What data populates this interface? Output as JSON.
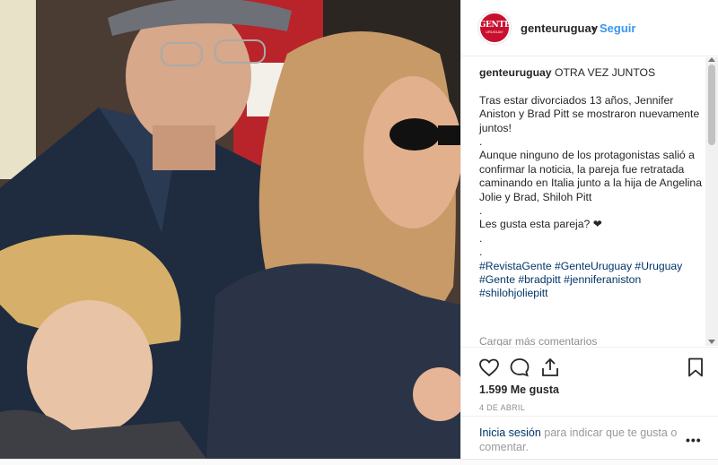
{
  "post": {
    "username": "genteuruguay",
    "dot": "•",
    "follow_label": "Seguir",
    "avatar_logo_main": "GENTE",
    "avatar_logo_sub": "URUGUAY",
    "photo_alt": "Foto del post"
  },
  "caption": {
    "username": "genteuruguay",
    "title": "OTRA VEZ JUNTOS",
    "para1": "Tras estar divorciados 13 años, Jennifer Aniston y Brad Pitt se mostraron nuevamente juntos!",
    "sep1": ".",
    "para2": "Aunque ninguno de los protagonistas salió a confirmar la noticia, la pareja fue retratada caminando en Italia junto a la hija de Angelina Jolie y Brad, Shiloh Pitt",
    "sep2": ".",
    "para3": "Les gusta esta pareja? ❤",
    "sep3": ".",
    "sep4": ".",
    "hashtags_line1": "#RevistaGente #GenteUruguay #Uruguay",
    "hashtags_line2": "#Gente #bradpitt #jenniferaniston",
    "hashtags_line3": "#shilohjoliepitt",
    "load_more": "Cargar más comentarios"
  },
  "actions": {
    "likes": "1.599 Me gusta",
    "date": "4 DE ABRIL",
    "login_link": "Inicia sesión",
    "login_rest": " para indicar que te gusta o comentar.",
    "more": "•••"
  },
  "icons": {
    "like": "heart-icon",
    "comment": "comment-icon",
    "share": "share-icon",
    "save": "bookmark-icon"
  },
  "colors": {
    "link_blue": "#3897f0",
    "hashtag_blue": "#003569",
    "brand_red": "#c8102e"
  }
}
